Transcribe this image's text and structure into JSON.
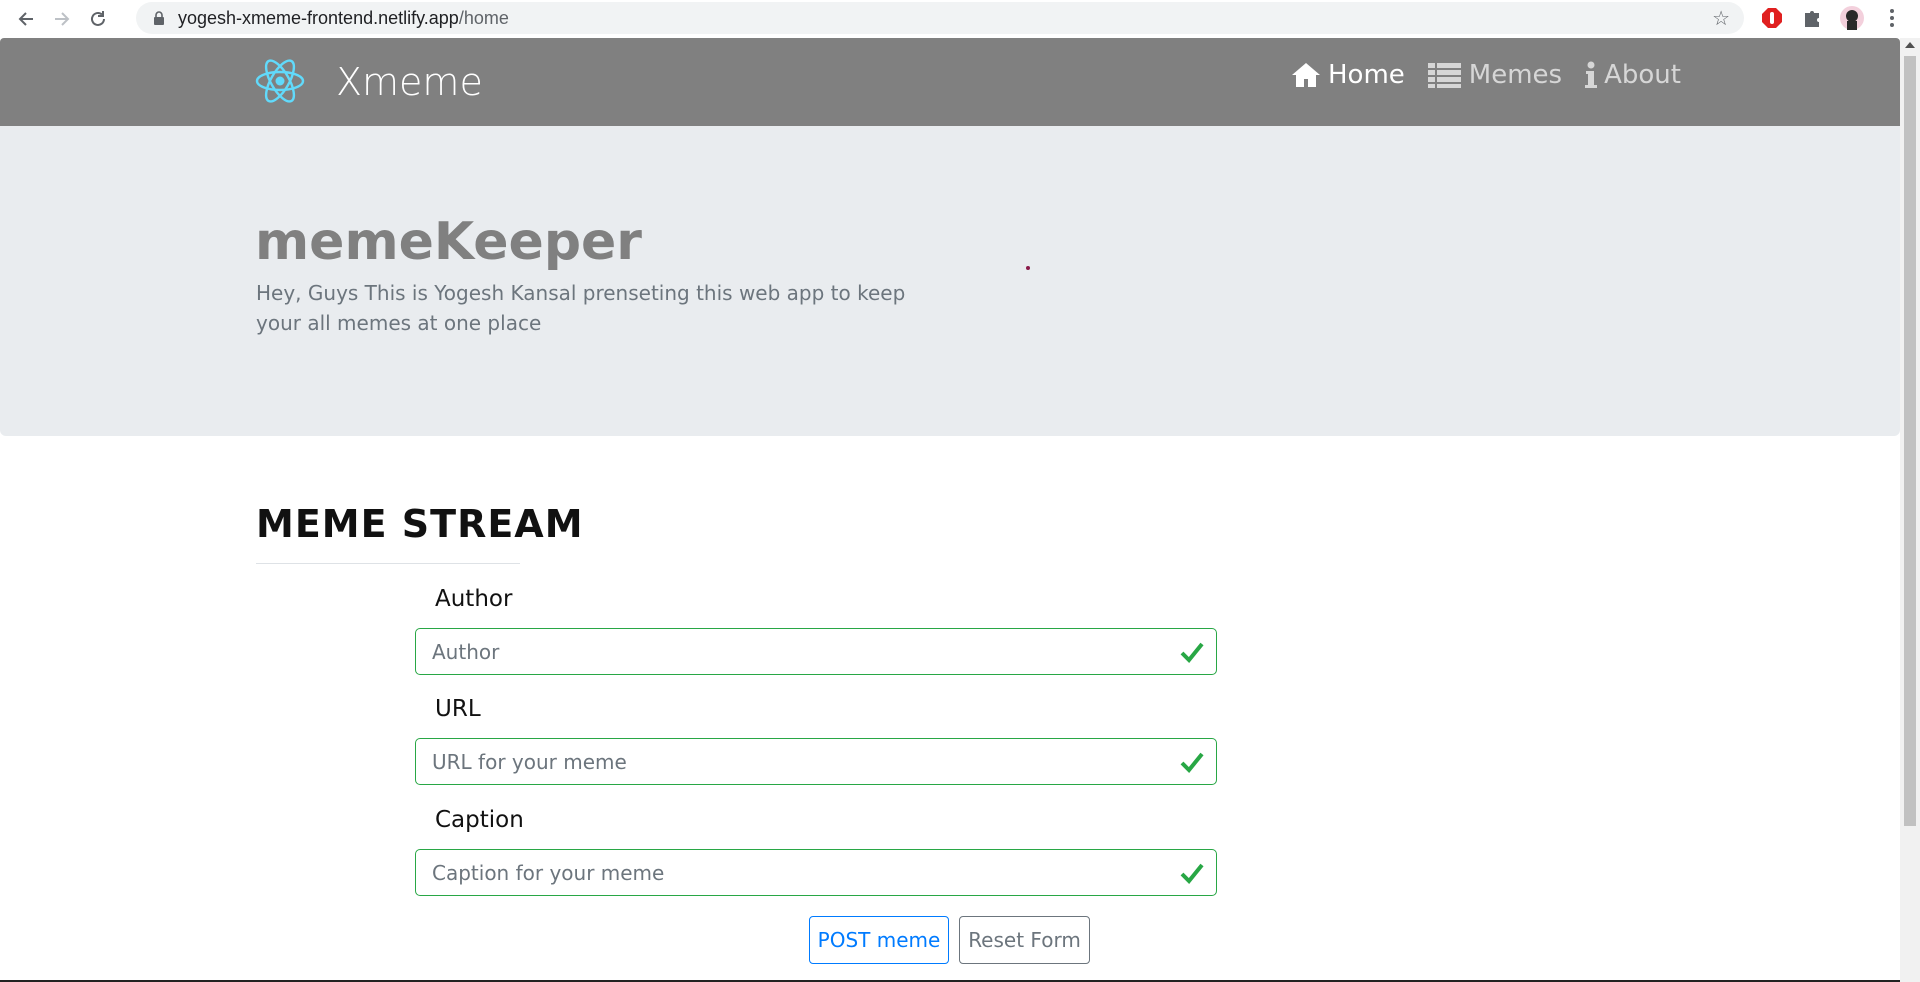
{
  "browser": {
    "url_host": "yogesh-xmeme-frontend.netlify.app",
    "url_path": "/home"
  },
  "navbar": {
    "brand": "Xmeme",
    "links": [
      {
        "label": "Home",
        "icon": "home-icon",
        "active": true
      },
      {
        "label": "Memes",
        "icon": "list-icon",
        "active": false
      },
      {
        "label": "About",
        "icon": "info-icon",
        "active": false
      }
    ]
  },
  "jumbotron": {
    "title": "memeKeeper",
    "subtitle": "Hey, Guys This is Yogesh Kansal prenseting this web app to keep your all memes at one place"
  },
  "stream": {
    "title": "MEME STREAM",
    "fields": [
      {
        "label": "Author",
        "placeholder": "Author",
        "value": ""
      },
      {
        "label": "URL",
        "placeholder": "URL for your meme",
        "value": ""
      },
      {
        "label": "Caption",
        "placeholder": "Caption for your meme",
        "value": ""
      }
    ],
    "post_button": "POST meme",
    "reset_button": "Reset Form"
  },
  "colors": {
    "navbar_bg": "#808080",
    "jumbotron_bg": "#e9ecef",
    "valid_green": "#28a745",
    "primary_blue": "#007bff",
    "react_logo": "#61dafb"
  }
}
